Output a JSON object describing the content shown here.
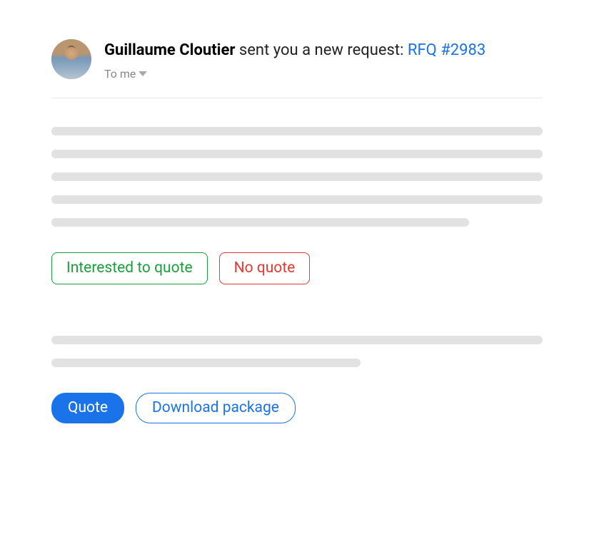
{
  "header": {
    "sender_name": "Guillaume Cloutier",
    "subject_suffix": " sent you a new request: ",
    "rfq_link": "RFQ #2983",
    "recipient": "To me"
  },
  "actions": {
    "interested": "Interested to quote",
    "no_quote": "No quote",
    "quote": "Quote",
    "download": "Download package"
  }
}
